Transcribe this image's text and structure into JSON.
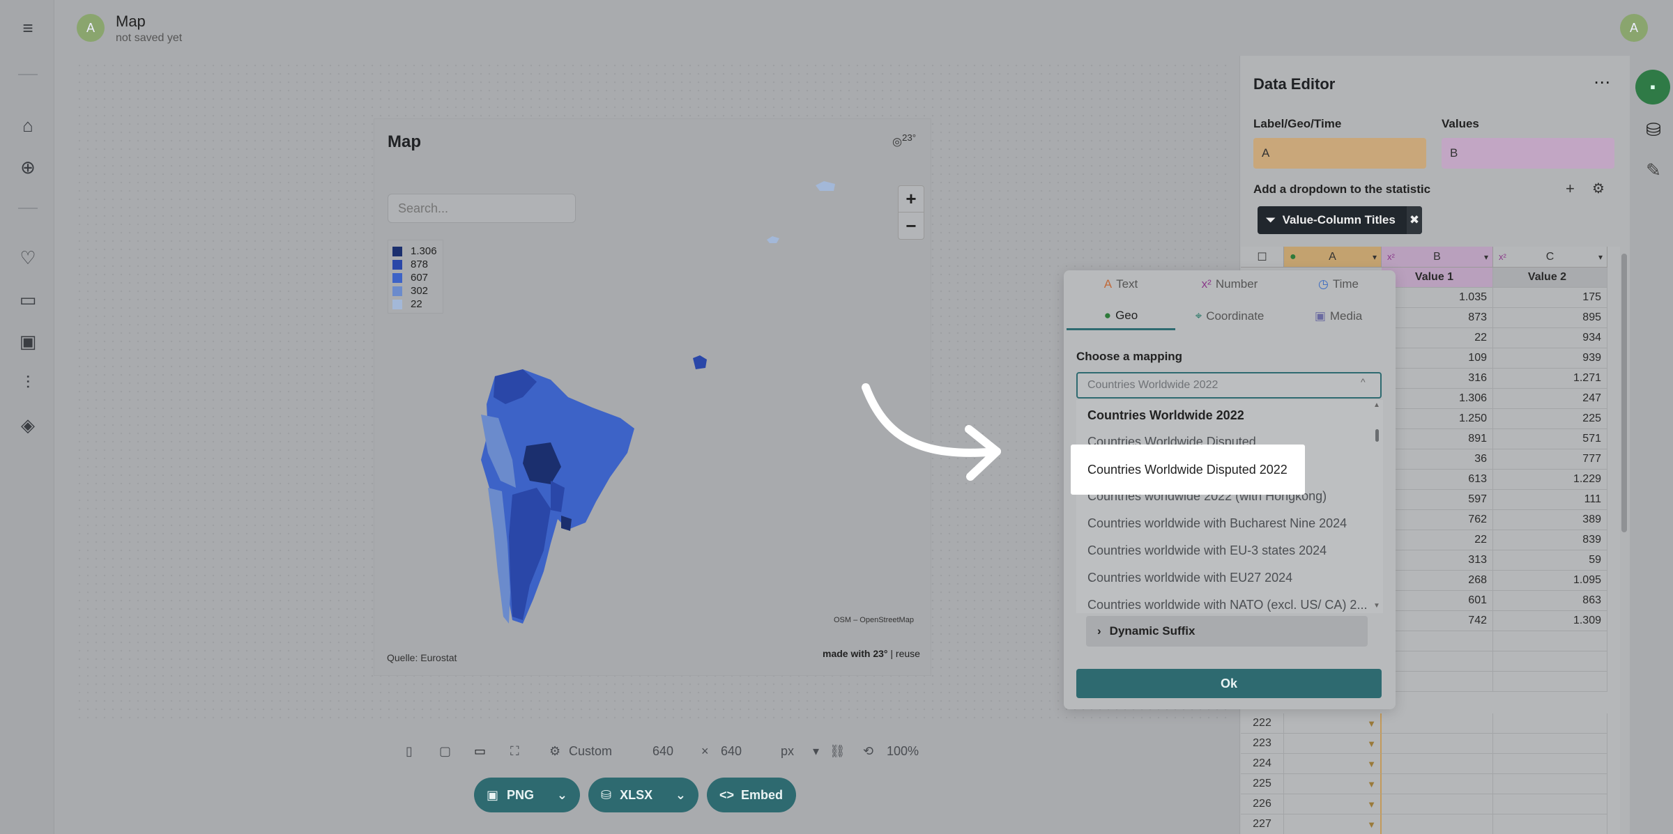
{
  "header": {
    "avatar_letter": "A",
    "title": "Map",
    "subtitle": "not saved yet"
  },
  "map": {
    "title": "Map",
    "search_placeholder": "Search...",
    "legend": [
      {
        "label": "1.306",
        "color": "#1b2f6e"
      },
      {
        "label": "878",
        "color": "#2a47a8"
      },
      {
        "label": "607",
        "color": "#3d63c7"
      },
      {
        "label": "302",
        "color": "#6b8bcc"
      },
      {
        "label": "22",
        "color": "#a3b8d8"
      }
    ],
    "zoom_in": "+",
    "zoom_out": "−",
    "attribution": "OSM – OpenStreetMap",
    "source": "Quelle: Eurostat",
    "made_with": "made with 23°",
    "reuse": "| reuse"
  },
  "toolbar": {
    "size_label": "Custom",
    "width": "640",
    "x": "×",
    "height": "640",
    "unit": "px",
    "zoom": "100%"
  },
  "export": {
    "png": "PNG",
    "xlsx": "XLSX",
    "embed": "Embed"
  },
  "editor": {
    "title": "Data Editor",
    "label_geo_time": "Label/Geo/Time",
    "values": "Values",
    "field_a": "A",
    "field_b": "B",
    "add_dropdown": "Add a dropdown to the statistic",
    "chip_label": "Value-Column Titles",
    "columns": {
      "a": "A",
      "b": "B",
      "c": "C"
    },
    "value_headers": {
      "b": "Value 1",
      "c": "Value 2"
    },
    "rows_b": [
      "1.035",
      "873",
      "22",
      "109",
      "316",
      "1.306",
      "1.250",
      "891",
      "36",
      "613",
      "597",
      "762",
      "22",
      "313",
      "268",
      "601",
      "742"
    ],
    "rows_c": [
      "175",
      "895",
      "934",
      "939",
      "1.271",
      "247",
      "225",
      "571",
      "777",
      "1.229",
      "111",
      "389",
      "839",
      "59",
      "1.095",
      "863",
      "1.309"
    ],
    "row_numbers": [
      "222",
      "223",
      "224",
      "225",
      "226",
      "227"
    ]
  },
  "popup": {
    "tabs_row1": [
      "Text",
      "Number",
      "Time"
    ],
    "tabs_row2": [
      "Geo",
      "Coordinate",
      "Media"
    ],
    "choose_label": "Choose a mapping",
    "select_value": "Countries Worldwide 2022",
    "options": [
      "Countries Worldwide 2022",
      "Countries Worldwide Disputed",
      "Countries Worldwide Disputed 2022",
      "Countries worldwide 2022 (with Hongkong)",
      "Countries worldwide with Bucharest Nine 2024",
      "Countries worldwide with EU-3 states 2024",
      "Countries worldwide with EU27 2024",
      "Countries worldwide with NATO (excl. US/ CA) 2..."
    ],
    "highlighted": "Countries Worldwide Disputed 2022",
    "suffix": "Dynamic Suffix",
    "ok": "Ok"
  }
}
